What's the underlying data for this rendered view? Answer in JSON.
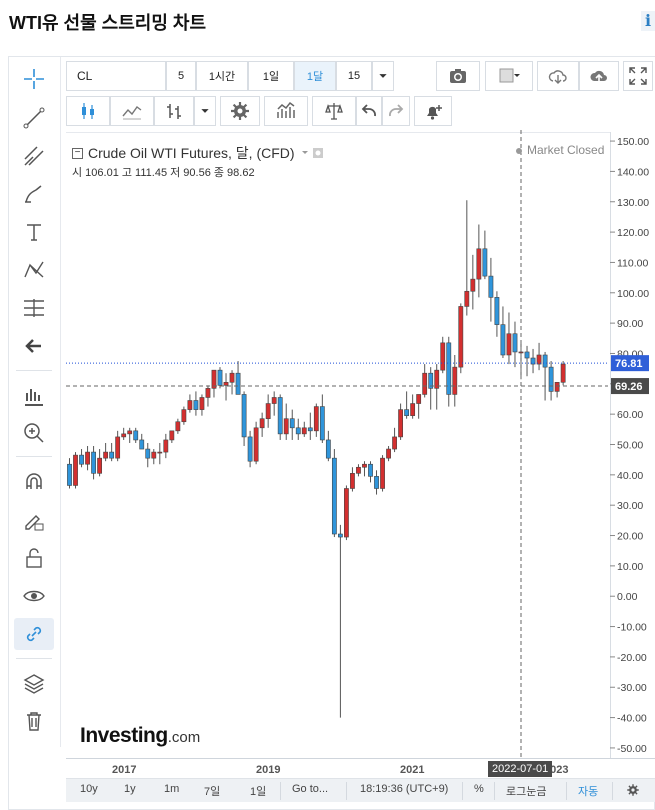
{
  "page_title": "WTI유 선물 스트리밍 차트",
  "info_icon": "i",
  "toolbar": {
    "symbol": "CL",
    "btn_5": "5",
    "btn_1h": "1시간",
    "btn_1d": "1일",
    "btn_1mo": "1달",
    "btn_15": "15"
  },
  "legend": {
    "name": "Crude Oil WTI Futures, 달, (CFD)",
    "ohlc": "시 106.01 고 111.45 저 90.56 종 98.62",
    "market_status": "Market Closed"
  },
  "logo": {
    "main": "Investing",
    "suffix": ".com"
  },
  "bottom_bar": {
    "ranges": [
      "10y",
      "1y",
      "1m",
      "7일",
      "1일"
    ],
    "goto": "Go to...",
    "time": "18:19:36 (UTC+9)",
    "percent": "%",
    "log": "로그눈금",
    "auto": "자동"
  },
  "colors": {
    "up": "#d32f2f",
    "down": "#2f95db",
    "accent": "#2f8fd8"
  },
  "chart_data": {
    "type": "candlestick",
    "title": "Crude Oil WTI Futures, 달, (CFD)",
    "ylim": [
      -52,
      152
    ],
    "y_ticks": [
      "150.00",
      "140.00",
      "130.00",
      "120.00",
      "110.00",
      "100.00",
      "90.00",
      "80.00",
      "70.00",
      "60.00",
      "50.00",
      "40.00",
      "30.00",
      "20.00",
      "10.00",
      "0.00",
      "-10.00",
      "-20.00",
      "-30.00",
      "-40.00",
      "-50.00"
    ],
    "x_ticks": [
      "2017",
      "2019",
      "2021",
      "2023"
    ],
    "crosshair": {
      "date": "2022-07-01",
      "price": "69.26"
    },
    "last_price": "76.81",
    "candles": [
      {
        "o": 43.5,
        "h": 45.5,
        "l": 35.5,
        "c": 36.5
      },
      {
        "o": 36.5,
        "h": 47.5,
        "l": 35.5,
        "c": 46.5
      },
      {
        "o": 46.5,
        "h": 48.5,
        "l": 42.5,
        "c": 43.5
      },
      {
        "o": 43.5,
        "h": 49.5,
        "l": 41.5,
        "c": 47.5
      },
      {
        "o": 47.5,
        "h": 49.5,
        "l": 38.5,
        "c": 40.5
      },
      {
        "o": 40.5,
        "h": 48.5,
        "l": 39.5,
        "c": 45.5
      },
      {
        "o": 45.5,
        "h": 50.5,
        "l": 44.5,
        "c": 47.5
      },
      {
        "o": 47.5,
        "h": 50.5,
        "l": 44.5,
        "c": 45.5
      },
      {
        "o": 45.5,
        "h": 54.5,
        "l": 44.5,
        "c": 52.5
      },
      {
        "o": 52.5,
        "h": 55.5,
        "l": 51.5,
        "c": 53.5
      },
      {
        "o": 53.5,
        "h": 55.5,
        "l": 50.5,
        "c": 54.5
      },
      {
        "o": 54.5,
        "h": 55.5,
        "l": 50.5,
        "c": 51.5
      },
      {
        "o": 51.5,
        "h": 53.5,
        "l": 48.5,
        "c": 48.5
      },
      {
        "o": 48.5,
        "h": 50.5,
        "l": 42.5,
        "c": 45.5
      },
      {
        "o": 45.5,
        "h": 48.5,
        "l": 43.5,
        "c": 47.5
      },
      {
        "o": 47.5,
        "h": 50.5,
        "l": 43.5,
        "c": 47.5
      },
      {
        "o": 47.5,
        "h": 53.5,
        "l": 45.5,
        "c": 51.5
      },
      {
        "o": 51.5,
        "h": 54.5,
        "l": 50.5,
        "c": 54.5
      },
      {
        "o": 54.5,
        "h": 58.5,
        "l": 53.5,
        "c": 57.5
      },
      {
        "o": 57.5,
        "h": 62.5,
        "l": 56.5,
        "c": 61.5
      },
      {
        "o": 61.5,
        "h": 66.5,
        "l": 60.5,
        "c": 64.5
      },
      {
        "o": 64.5,
        "h": 67.5,
        "l": 59.5,
        "c": 61.5
      },
      {
        "o": 61.5,
        "h": 66.5,
        "l": 59.5,
        "c": 65.5
      },
      {
        "o": 65.5,
        "h": 69.5,
        "l": 62.5,
        "c": 68.5
      },
      {
        "o": 68.5,
        "h": 74.5,
        "l": 65.5,
        "c": 74.5
      },
      {
        "o": 74.5,
        "h": 75.5,
        "l": 68.5,
        "c": 69.5
      },
      {
        "o": 69.5,
        "h": 73.5,
        "l": 64.5,
        "c": 70.5
      },
      {
        "o": 70.5,
        "h": 74.5,
        "l": 66.5,
        "c": 73.5
      },
      {
        "o": 73.5,
        "h": 77.5,
        "l": 67.5,
        "c": 66.5
      },
      {
        "o": 66.5,
        "h": 67.5,
        "l": 49.5,
        "c": 52.5
      },
      {
        "o": 52.5,
        "h": 54.5,
        "l": 42.5,
        "c": 44.5
      },
      {
        "o": 44.5,
        "h": 57.5,
        "l": 43.5,
        "c": 55.5
      },
      {
        "o": 55.5,
        "h": 60.5,
        "l": 52.5,
        "c": 58.5
      },
      {
        "o": 58.5,
        "h": 66.5,
        "l": 55.5,
        "c": 63.5
      },
      {
        "o": 63.5,
        "h": 67.5,
        "l": 59.5,
        "c": 65.5
      },
      {
        "o": 65.5,
        "h": 66.5,
        "l": 51.5,
        "c": 53.5
      },
      {
        "o": 53.5,
        "h": 63.5,
        "l": 51.5,
        "c": 58.5
      },
      {
        "o": 58.5,
        "h": 61.5,
        "l": 51.5,
        "c": 55.5
      },
      {
        "o": 55.5,
        "h": 58.5,
        "l": 51.5,
        "c": 53.5
      },
      {
        "o": 53.5,
        "h": 57.5,
        "l": 52.5,
        "c": 55.5
      },
      {
        "o": 55.5,
        "h": 60.5,
        "l": 51.5,
        "c": 54.5
      },
      {
        "o": 54.5,
        "h": 63.5,
        "l": 52.5,
        "c": 62.5
      },
      {
        "o": 62.5,
        "h": 66.5,
        "l": 50.5,
        "c": 51.5
      },
      {
        "o": 51.5,
        "h": 54.5,
        "l": 44.5,
        "c": 45.5
      },
      {
        "o": 45.5,
        "h": 48.5,
        "l": 19.5,
        "c": 20.5
      },
      {
        "o": 20.5,
        "h": 23.5,
        "l": -40.0,
        "c": 19.5
      },
      {
        "o": 19.5,
        "h": 36.5,
        "l": 18.5,
        "c": 35.5
      },
      {
        "o": 35.5,
        "h": 42.5,
        "l": 34.5,
        "c": 40.5
      },
      {
        "o": 40.5,
        "h": 43.5,
        "l": 39.5,
        "c": 42.5
      },
      {
        "o": 42.5,
        "h": 44.5,
        "l": 39.5,
        "c": 43.5
      },
      {
        "o": 43.5,
        "h": 44.5,
        "l": 37.5,
        "c": 39.5
      },
      {
        "o": 39.5,
        "h": 41.5,
        "l": 33.5,
        "c": 35.5
      },
      {
        "o": 35.5,
        "h": 46.5,
        "l": 34.5,
        "c": 45.5
      },
      {
        "o": 45.5,
        "h": 49.5,
        "l": 44.5,
        "c": 48.5
      },
      {
        "o": 48.5,
        "h": 55.5,
        "l": 47.5,
        "c": 52.5
      },
      {
        "o": 52.5,
        "h": 63.5,
        "l": 51.5,
        "c": 61.5
      },
      {
        "o": 61.5,
        "h": 67.5,
        "l": 58.5,
        "c": 59.5
      },
      {
        "o": 59.5,
        "h": 66.5,
        "l": 58.5,
        "c": 63.5
      },
      {
        "o": 63.5,
        "h": 66.5,
        "l": 58.5,
        "c": 66.5
      },
      {
        "o": 66.5,
        "h": 76.5,
        "l": 65.5,
        "c": 73.5
      },
      {
        "o": 73.5,
        "h": 75.5,
        "l": 61.5,
        "c": 68.5
      },
      {
        "o": 68.5,
        "h": 76.5,
        "l": 61.5,
        "c": 74.5
      },
      {
        "o": 74.5,
        "h": 85.5,
        "l": 73.5,
        "c": 83.5
      },
      {
        "o": 83.5,
        "h": 85.5,
        "l": 62.5,
        "c": 66.5
      },
      {
        "o": 66.5,
        "h": 79.5,
        "l": 62.5,
        "c": 75.5
      },
      {
        "o": 75.5,
        "h": 96.5,
        "l": 73.5,
        "c": 95.5
      },
      {
        "o": 95.5,
        "h": 130.5,
        "l": 92.5,
        "c": 100.5
      },
      {
        "o": 100.5,
        "h": 112.5,
        "l": 94.5,
        "c": 104.5
      },
      {
        "o": 104.5,
        "h": 122.5,
        "l": 98.5,
        "c": 114.5
      },
      {
        "o": 114.5,
        "h": 120.5,
        "l": 104.5,
        "c": 105.5
      },
      {
        "o": 105.5,
        "h": 111.5,
        "l": 90.5,
        "c": 98.5
      },
      {
        "o": 98.5,
        "h": 100.5,
        "l": 85.5,
        "c": 89.5
      },
      {
        "o": 89.5,
        "h": 95.5,
        "l": 78.5,
        "c": 79.5
      },
      {
        "o": 79.5,
        "h": 93.5,
        "l": 76.5,
        "c": 86.5
      },
      {
        "o": 86.5,
        "h": 90.5,
        "l": 75.5,
        "c": 80.5
      },
      {
        "o": 80.5,
        "h": 83.5,
        "l": 71.5,
        "c": 80.5
      },
      {
        "o": 80.5,
        "h": 82.5,
        "l": 72.5,
        "c": 78.5
      },
      {
        "o": 78.5,
        "h": 81.5,
        "l": 73.5,
        "c": 76.5
      },
      {
        "o": 76.5,
        "h": 83.5,
        "l": 74.5,
        "c": 79.5
      },
      {
        "o": 79.5,
        "h": 80.5,
        "l": 64.5,
        "c": 75.5
      },
      {
        "o": 75.5,
        "h": 77.5,
        "l": 64.5,
        "c": 67.5
      },
      {
        "o": 67.5,
        "h": 70.5,
        "l": 65.5,
        "c": 70.5
      },
      {
        "o": 70.5,
        "h": 77.5,
        "l": 69.5,
        "c": 76.5
      }
    ]
  }
}
